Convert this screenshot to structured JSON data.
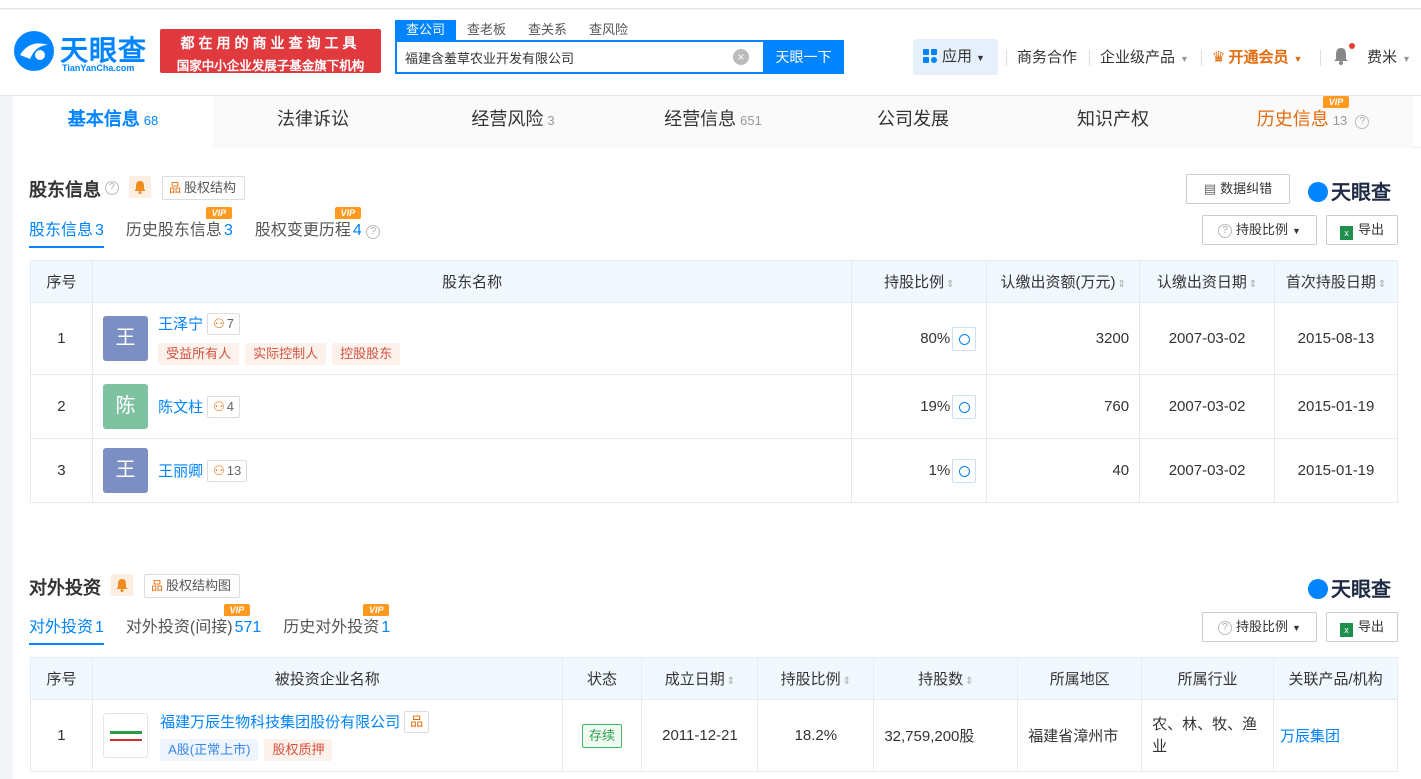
{
  "header": {
    "logo_text": "天眼查",
    "logo_sub": "TianYanCha.com",
    "slogan_line1": "都在用的商业查询工具",
    "slogan_line2": "国家中小企业发展子基金旗下机构",
    "search_tabs": [
      "查公司",
      "查老板",
      "查关系",
      "查风险"
    ],
    "search_value": "福建含羞草农业开发有限公司",
    "search_button": "天眼一下",
    "app_button": "应用",
    "nav_business": "商务合作",
    "nav_enterprise": "企业级产品",
    "nav_vip": "开通会员",
    "user_name": "费米"
  },
  "main_tabs": [
    {
      "label": "基本信息",
      "count": "68"
    },
    {
      "label": "法律诉讼",
      "count": ""
    },
    {
      "label": "经营风险",
      "count": "3"
    },
    {
      "label": "经营信息",
      "count": "651"
    },
    {
      "label": "公司发展",
      "count": ""
    },
    {
      "label": "知识产权",
      "count": ""
    },
    {
      "label": "历史信息",
      "count": "13"
    }
  ],
  "vip_label": "VIP",
  "shareholders": {
    "title": "股东信息",
    "structure_button": "股权结构",
    "correct_button": "数据纠错",
    "brand": "天眼查",
    "ratio_button": "持股比例",
    "export_button": "导出",
    "subtabs": [
      {
        "label": "股东信息",
        "count": "3"
      },
      {
        "label": "历史股东信息",
        "count": "3"
      },
      {
        "label": "股权变更历程",
        "count": "4"
      }
    ],
    "columns": [
      "序号",
      "股东名称",
      "持股比例",
      "认缴出资额(万元)",
      "认缴出资日期",
      "首次持股日期"
    ],
    "rows": [
      {
        "no": "1",
        "avatar": "王",
        "avatar_color": "#7b8fc4",
        "name": "王泽宁",
        "count": "7",
        "tags": [
          "受益所有人",
          "实际控制人",
          "控股股东"
        ],
        "ratio": "80%",
        "amount": "3200",
        "date1": "2007-03-02",
        "date2": "2015-08-13"
      },
      {
        "no": "2",
        "avatar": "陈",
        "avatar_color": "#7fc2a2",
        "name": "陈文柱",
        "count": "4",
        "tags": [],
        "ratio": "19%",
        "amount": "760",
        "date1": "2007-03-02",
        "date2": "2015-01-19"
      },
      {
        "no": "3",
        "avatar": "王",
        "avatar_color": "#7b8fc4",
        "name": "王丽卿",
        "count": "13",
        "tags": [],
        "ratio": "1%",
        "amount": "40",
        "date1": "2007-03-02",
        "date2": "2015-01-19"
      }
    ]
  },
  "investments": {
    "title": "对外投资",
    "structure_button": "股权结构图",
    "brand": "天眼查",
    "ratio_button": "持股比例",
    "export_button": "导出",
    "subtabs": [
      {
        "label": "对外投资",
        "count": "1"
      },
      {
        "label": "对外投资(间接)",
        "count": "571"
      },
      {
        "label": "历史对外投资",
        "count": "1"
      }
    ],
    "columns": [
      "序号",
      "被投资企业名称",
      "状态",
      "成立日期",
      "持股比例",
      "持股数",
      "所属地区",
      "所属行业",
      "关联产品/机构"
    ],
    "rows": [
      {
        "no": "1",
        "name": "福建万辰生物科技集团股份有限公司",
        "tags": [
          "A股(正常上市)",
          "股权质押"
        ],
        "status": "存续",
        "date": "2011-12-21",
        "ratio": "18.2%",
        "shares": "32,759,200股",
        "region": "福建省漳州市",
        "industry": "农、林、牧、渔业",
        "product": "万辰集团"
      }
    ]
  }
}
